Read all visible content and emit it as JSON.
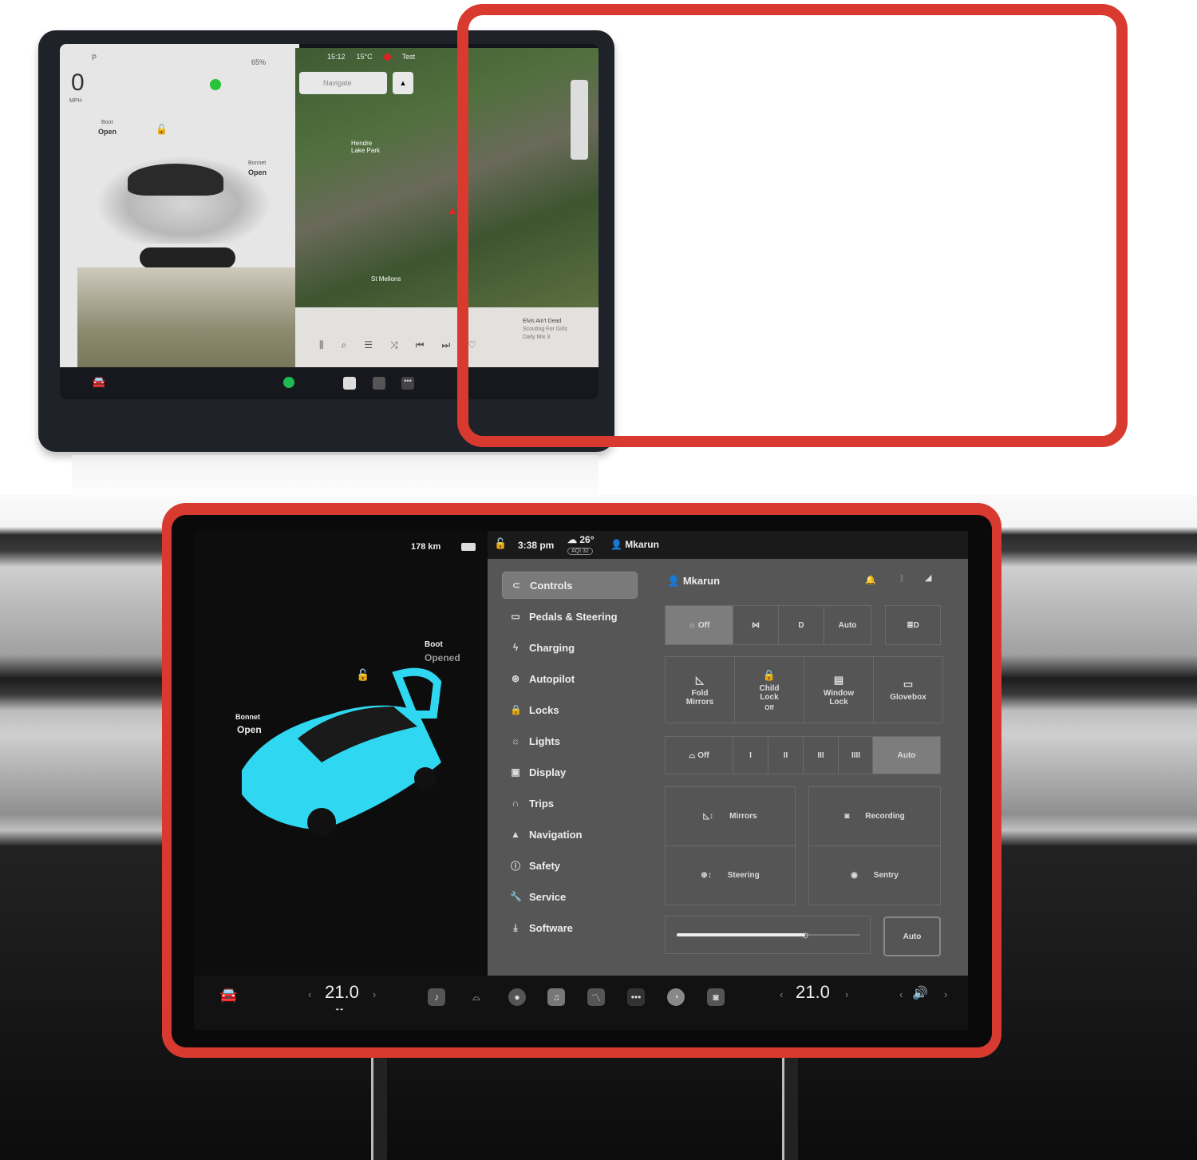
{
  "top_screen": {
    "gear": "P",
    "speed": "0",
    "speed_unit": "MPH",
    "battery": "65%",
    "boot_label": "Boot",
    "boot_state": "Open",
    "bonnet_label": "Bonnet",
    "bonnet_state": "Open",
    "status": {
      "time": "15:12",
      "temperature": "15°C",
      "user": "Test"
    },
    "navigate_placeholder": "Navigate",
    "map_labels": [
      "Hendre Lake Park",
      "St Mellons"
    ],
    "music": {
      "title": "Elvis Ain't Dead",
      "artist": "Scouting For Girls",
      "source": "Daily Mix 3"
    }
  },
  "frame_color": "#d83a2f",
  "bottom_screen": {
    "range": "178 km",
    "boot_label": "Boot",
    "boot_state": "Opened",
    "bonnet_label": "Bonnet",
    "bonnet_state": "Open",
    "car_color": "#2fd8f0",
    "status": {
      "time": "3:38 pm",
      "temperature": "26°",
      "aqi": "AQI 32",
      "user": "Mkarun"
    },
    "sidebar": [
      {
        "label": "Controls",
        "icon": "toggle-icon",
        "active": true
      },
      {
        "label": "Pedals & Steering",
        "icon": "car-icon"
      },
      {
        "label": "Charging",
        "icon": "bolt-icon"
      },
      {
        "label": "Autopilot",
        "icon": "steering-wheel-icon"
      },
      {
        "label": "Locks",
        "icon": "lock-icon"
      },
      {
        "label": "Lights",
        "icon": "sun-icon"
      },
      {
        "label": "Display",
        "icon": "display-icon"
      },
      {
        "label": "Trips",
        "icon": "trips-icon"
      },
      {
        "label": "Navigation",
        "icon": "navigation-icon"
      },
      {
        "label": "Safety",
        "icon": "safety-icon"
      },
      {
        "label": "Service",
        "icon": "wrench-icon"
      },
      {
        "label": "Software",
        "icon": "download-icon"
      }
    ],
    "profile_name": "Mkarun",
    "lights": {
      "off": "Off",
      "auto": "Auto",
      "selected": "Off"
    },
    "quick": [
      {
        "label": "Fold Mirrors",
        "sub": ""
      },
      {
        "label": "Child Lock",
        "sub": "Off"
      },
      {
        "label": "Window Lock",
        "sub": ""
      },
      {
        "label": "Glovebox",
        "sub": ""
      }
    ],
    "wipers": {
      "off": "Off",
      "levels": [
        "I",
        "II",
        "III",
        "IIII"
      ],
      "auto": "Auto",
      "selected": "Auto"
    },
    "adjust": {
      "mirrors": "Mirrors",
      "steering": "Steering",
      "recording": "Recording",
      "sentry": "Sentry"
    },
    "brightness": {
      "level_percent": 70,
      "auto": "Auto"
    },
    "climate": {
      "driver_temp": "21.0",
      "passenger_temp": "21.0"
    }
  }
}
